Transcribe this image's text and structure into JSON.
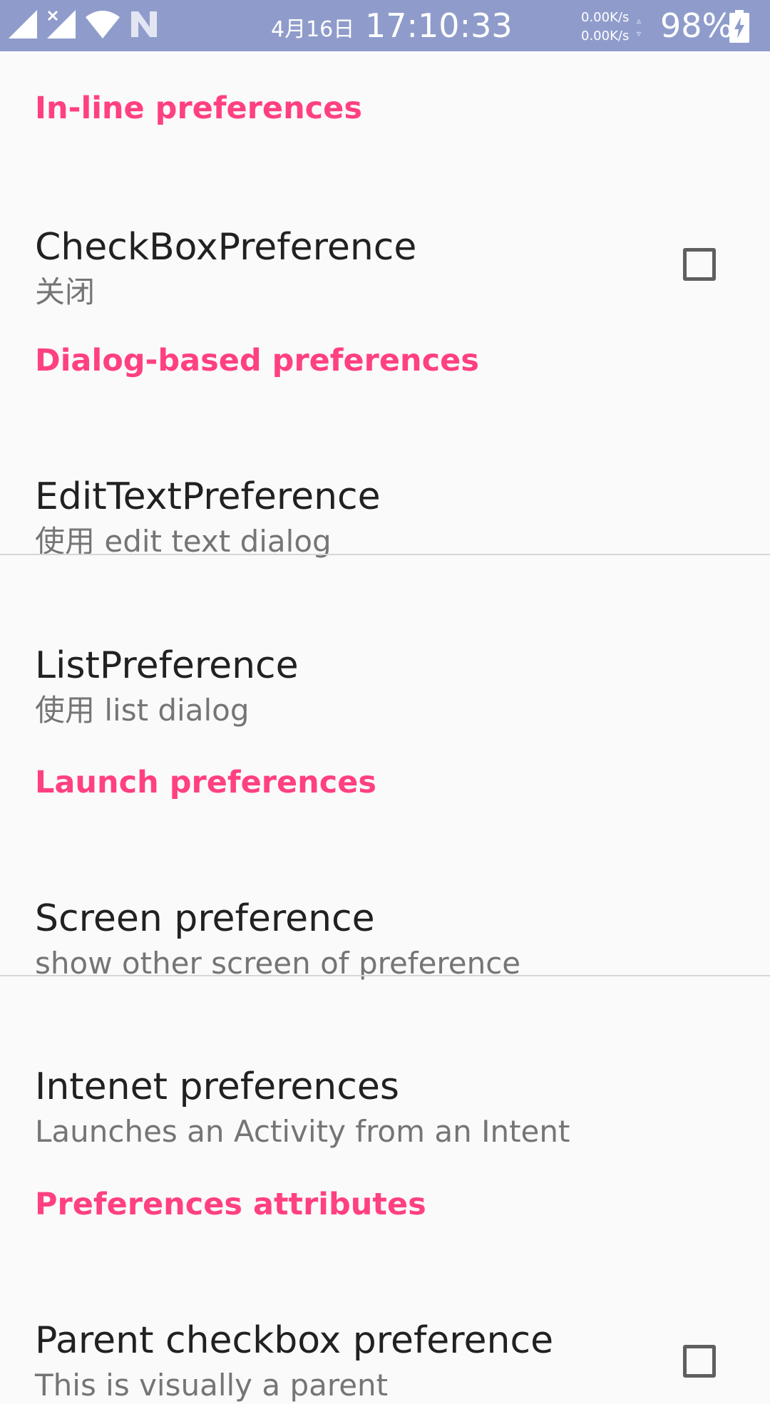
{
  "status_bar": {
    "date": "4月16日",
    "time": "17:10:33",
    "net_speed_up": "0.00K/s",
    "net_speed_down": "0.00K/s",
    "net_arrows": "▵\n▿",
    "battery_percent": "98%",
    "icons": [
      "signal-icon",
      "signal-no-sim-icon",
      "wifi-icon",
      "nfc-icon",
      "battery-charging-icon"
    ]
  },
  "colors": {
    "status_bar_bg": "#8f9ccb",
    "accent": "#ff4081",
    "background": "#fafafa",
    "title_text": "#212121",
    "summary_text": "#757575"
  },
  "sections": [
    {
      "category": "In-line preferences",
      "items": [
        {
          "title": "CheckBoxPreference",
          "summary": "关闭",
          "widget": "checkbox",
          "checked": false
        }
      ]
    },
    {
      "category": "Dialog-based preferences",
      "items": [
        {
          "title": "EditTextPreference",
          "summary": "使用 edit text dialog"
        },
        {
          "title": "ListPreference",
          "summary": "使用 list dialog"
        }
      ]
    },
    {
      "category": "Launch preferences",
      "items": [
        {
          "title": "Screen preference",
          "summary": "show other screen of preference"
        },
        {
          "title": "Intenet preferences",
          "summary": "Launches an Activity from an Intent"
        }
      ]
    },
    {
      "category": "Preferences attributes",
      "items": [
        {
          "title": "Parent checkbox preference",
          "summary": "This is visually a parent",
          "widget": "checkbox",
          "checked": false
        }
      ]
    }
  ]
}
